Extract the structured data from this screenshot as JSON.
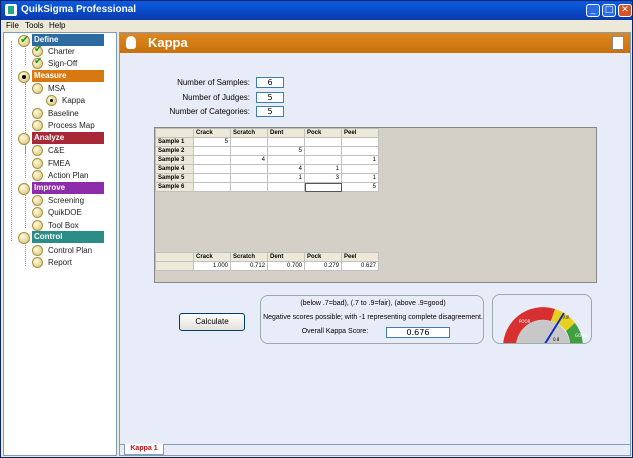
{
  "window": {
    "title": "QuikSigma Professional",
    "minimize": "_",
    "maximize": "□",
    "close": "✕"
  },
  "menu": [
    "File",
    "Tools",
    "Help"
  ],
  "sidebar": {
    "sections": [
      {
        "label": "Define",
        "color": "#2c6aa0",
        "items": [
          "Charter",
          "Sign-Off"
        ]
      },
      {
        "label": "Measure",
        "color": "#d87810",
        "items": [
          "MSA",
          "Kappa",
          "Baseline",
          "Process Map"
        ]
      },
      {
        "label": "Analyze",
        "color": "#a82838",
        "items": [
          "C&E",
          "FMEA",
          "Action Plan"
        ]
      },
      {
        "label": "Improve",
        "color": "#8c2ca8",
        "items": [
          "Screening",
          "QuikDOE",
          "Tool Box"
        ]
      },
      {
        "label": "Control",
        "color": "#2c8c88",
        "items": [
          "Control Plan",
          "Report"
        ]
      }
    ]
  },
  "header": {
    "title": "Kappa"
  },
  "form": {
    "samples_label": "Number of Samples:",
    "samples_value": "6",
    "judges_label": "Number of Judges:",
    "judges_value": "5",
    "categories_label": "Number of Categories:",
    "categories_value": "5"
  },
  "grid": {
    "columns": [
      "Crack",
      "Scratch",
      "Dent",
      "Pock",
      "Peel"
    ],
    "rows": [
      {
        "label": "Sample 1",
        "cells": [
          "5",
          "",
          "",
          "",
          ""
        ]
      },
      {
        "label": "Sample 2",
        "cells": [
          "",
          "",
          "5",
          "",
          ""
        ]
      },
      {
        "label": "Sample 3",
        "cells": [
          "",
          "4",
          "",
          "",
          "1"
        ]
      },
      {
        "label": "Sample 4",
        "cells": [
          "",
          "",
          "4",
          "1",
          ""
        ]
      },
      {
        "label": "Sample 5",
        "cells": [
          "",
          "",
          "1",
          "3",
          "1"
        ]
      },
      {
        "label": "Sample 6",
        "cells": [
          "",
          "",
          "",
          "",
          "5"
        ]
      }
    ],
    "results": [
      "1.000",
      "0.712",
      "0.700",
      "0.279",
      "0.627"
    ]
  },
  "calculate_label": "Calculate",
  "info": {
    "line1": "(below .7=bad), (.7 to .9=fair), (above .9=good)",
    "line2": "Negative scores possible; with -1 representing complete disagreement.",
    "score_label": "Overall Kappa Score:",
    "score_value": "0.676"
  },
  "gauge": {
    "value": 0.676,
    "label_bad": "POOR",
    "label_fair": "FAIR",
    "label_good": "GOOD",
    "center": "0.8"
  },
  "tab_label": "Kappa 1"
}
